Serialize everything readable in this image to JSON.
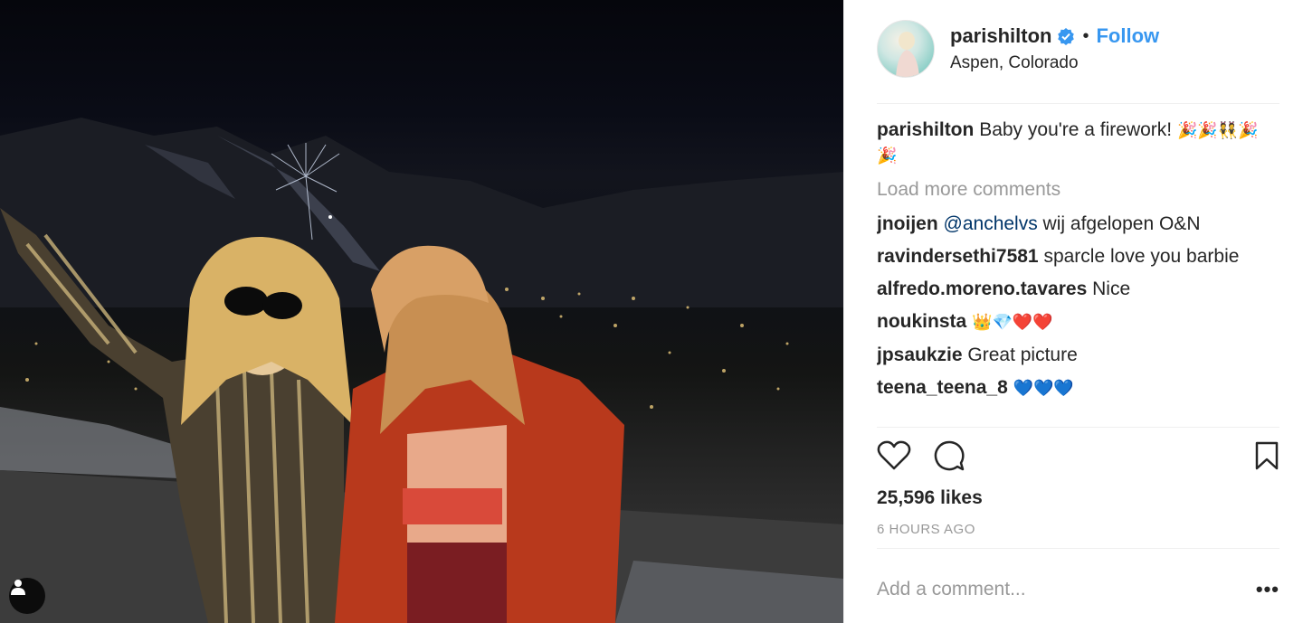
{
  "post": {
    "username": "parishilton",
    "follow_label": "Follow",
    "location": "Aspen, Colorado",
    "separator": "•"
  },
  "caption": {
    "username": "parishilton",
    "text": "Baby you're a firework!",
    "emojis": "🎉🎉👯🎉🎉"
  },
  "load_more": "Load more comments",
  "comments": [
    {
      "user": "jnoijen",
      "mention": "@anchelvs",
      "text": " wij afgelopen O&N"
    },
    {
      "user": "ravindersethi7581",
      "text": "sparcle love you barbie"
    },
    {
      "user": "alfredo.moreno.tavares",
      "text": "Nice"
    },
    {
      "user": "noukinsta",
      "text": "👑💎❤️❤️"
    },
    {
      "user": "jpsaukzie",
      "text": "Great picture"
    },
    {
      "user": "teena_teena_8",
      "text": "💙💙💙"
    }
  ],
  "likes": "25,596 likes",
  "time": "6 HOURS AGO",
  "add_comment_placeholder": "Add a comment...",
  "more_label": "•••",
  "colors": {
    "link": "#3897f0",
    "muted": "#999999",
    "divider": "#efefef",
    "verified": "#3897f0"
  },
  "icons": [
    "heart-icon",
    "comment-icon",
    "bookmark-icon",
    "verified-badge-icon",
    "user-tag-icon"
  ]
}
